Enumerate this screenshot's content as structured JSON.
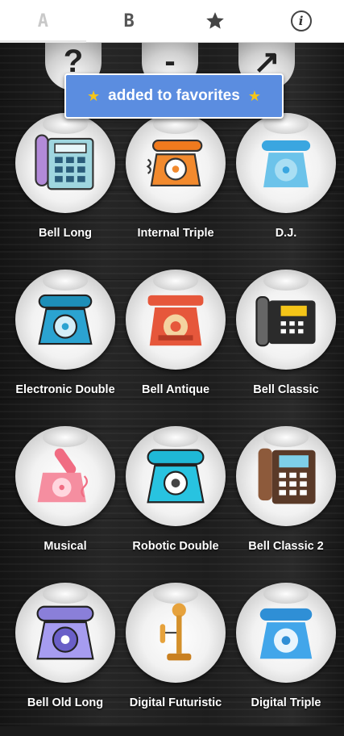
{
  "tabs": [
    {
      "label": "A",
      "active": true
    },
    {
      "label": "B",
      "active": false
    },
    {
      "label": "",
      "icon": "star-icon"
    },
    {
      "label": "i",
      "icon": "info-icon"
    }
  ],
  "top_buttons": [
    {
      "icon": "help-icon",
      "glyph": "?"
    },
    {
      "icon": "minus-icon",
      "glyph": "-"
    },
    {
      "icon": "share-icon",
      "glyph": "↗"
    }
  ],
  "toast": {
    "message": "added to favorites",
    "star_left": "★",
    "star_right": "★",
    "star_color": "#f5c518"
  },
  "ringtones": [
    {
      "label": "Bell Long",
      "icon": "office-phone-icon"
    },
    {
      "label": "Internal Triple",
      "icon": "orange-rotary-phone-icon"
    },
    {
      "label": "D.J.",
      "icon": "blue-rotary-phone-icon"
    },
    {
      "label": "Electronic Double",
      "icon": "teal-rotary-phone-icon"
    },
    {
      "label": "Bell Antique",
      "icon": "antique-red-phone-icon"
    },
    {
      "label": "Bell Classic",
      "icon": "desk-phone-icon"
    },
    {
      "label": "Musical",
      "icon": "pink-rotary-phone-icon"
    },
    {
      "label": "Robotic Double",
      "icon": "cyan-rotary-phone-icon"
    },
    {
      "label": "Bell Classic 2",
      "icon": "brown-office-phone-icon"
    },
    {
      "label": "Bell Old Long",
      "icon": "purple-rotary-phone-icon"
    },
    {
      "label": "Digital Futuristic",
      "icon": "candlestick-phone-icon"
    },
    {
      "label": "Digital Triple",
      "icon": "sky-rotary-phone-icon"
    }
  ],
  "colors": {
    "toast_bg": "#5b8de0",
    "label": "#ffffff",
    "tab_bg": "#ffffff"
  }
}
